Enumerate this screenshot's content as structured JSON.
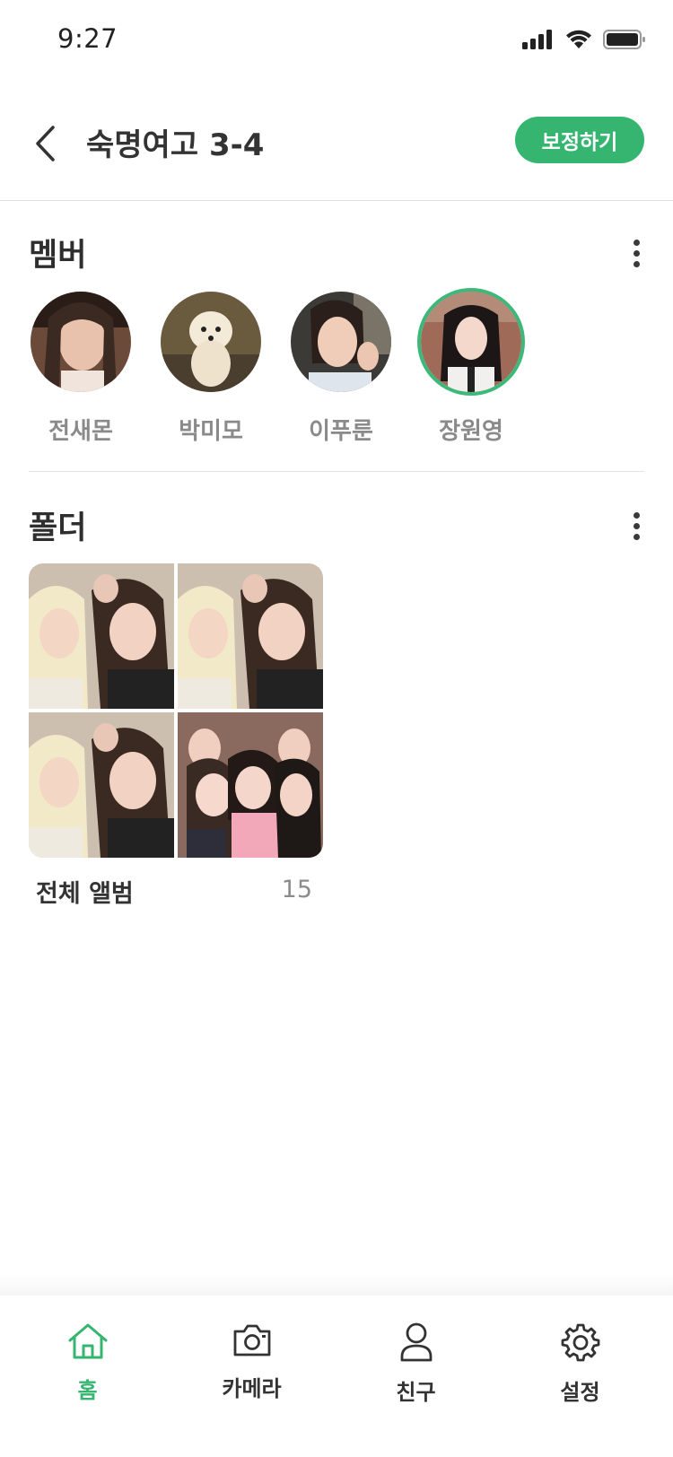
{
  "status_bar": {
    "time": "9:27"
  },
  "header": {
    "title": "숙명여고 3-4",
    "action_label": "보정하기"
  },
  "members": {
    "title": "멤버",
    "items": [
      {
        "name": "전새몬",
        "selected": false
      },
      {
        "name": "박미모",
        "selected": false
      },
      {
        "name": "이푸룬",
        "selected": false
      },
      {
        "name": "장원영",
        "selected": true
      }
    ]
  },
  "folders": {
    "title": "폴더",
    "items": [
      {
        "name": "전체 앨범",
        "count": "15"
      }
    ]
  },
  "bottom_nav": {
    "items": [
      {
        "label": "홈",
        "icon": "home-icon",
        "active": true
      },
      {
        "label": "카메라",
        "icon": "camera-icon",
        "active": false
      },
      {
        "label": "친구",
        "icon": "person-icon",
        "active": false
      },
      {
        "label": "설정",
        "icon": "gear-icon",
        "active": false
      }
    ]
  },
  "colors": {
    "accent": "#35b56f",
    "text": "#2b2b2b",
    "muted": "#8a8a8a"
  }
}
